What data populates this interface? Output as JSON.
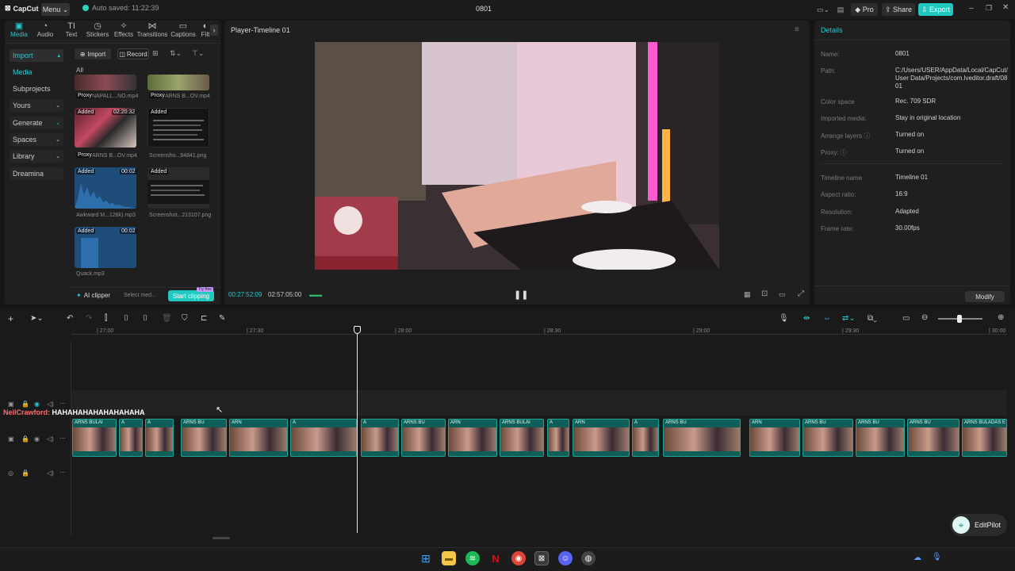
{
  "titlebar": {
    "app_name": "CapCut",
    "menu_label": "Menu",
    "autosave_text": "Auto saved: 11:22:39",
    "project_title": "0801",
    "pro_label": "Pro",
    "share_label": "Share",
    "export_label": "Export"
  },
  "toolbar": {
    "tools": [
      "Media",
      "Audio",
      "Text",
      "Stickers",
      "Effects",
      "Transitions",
      "Captions",
      "Filt"
    ]
  },
  "sidebar": {
    "items": [
      "Import",
      "Media",
      "Subprojects",
      "Yours",
      "Generate",
      "Spaces",
      "Library",
      "Dreamina"
    ]
  },
  "media": {
    "import_label": "Import",
    "record_label": "Record",
    "filter_all": "All",
    "items": [
      {
        "name": "NAPALL...NO.mp4",
        "badge": "Proxy",
        "duration": ""
      },
      {
        "name": "ARNS B...OV.mp4",
        "badge": "Proxy",
        "duration": ""
      },
      {
        "name": "ARNS B...OV.mp4",
        "badge": "Proxy",
        "added": "Added",
        "duration": "02:20:32"
      },
      {
        "name": "Screensho...94841.png",
        "badge": "",
        "added": "Added",
        "duration": ""
      },
      {
        "name": "Awkward M...128k).mp3",
        "badge": "",
        "added": "Added",
        "duration": "00:02"
      },
      {
        "name": "Screenshot...213107.png",
        "badge": "",
        "added": "Added",
        "duration": ""
      },
      {
        "name": "Quack.mp3",
        "badge": "",
        "added": "Added",
        "duration": "00:02"
      }
    ],
    "ai_clipper": "AI clipper",
    "select_media": "Select med...",
    "start_clipping": "Start clipping",
    "try_free": "Try free"
  },
  "player": {
    "title": "Player-Timeline 01",
    "current_time": "00:27:52:09",
    "total_time": "02:57:05:00"
  },
  "details": {
    "header": "Details",
    "rows": [
      {
        "label": "Name:",
        "value": "0801"
      },
      {
        "label": "Path:",
        "value": "C:/Users/USER/AppData/Local/CapCut/User Data/Projects/com.lveditor.draft/0801"
      },
      {
        "label": "Color space",
        "value": "Rec. 709 SDR"
      },
      {
        "label": "Imported media:",
        "value": "Stay in original location"
      },
      {
        "label": "Arrange layers",
        "value": "Turned on"
      },
      {
        "label": "Proxy:",
        "value": "Turned on"
      },
      {
        "label": "Timeline name",
        "value": "Timeline 01"
      },
      {
        "label": "Aspect ratio:",
        "value": "16:9"
      },
      {
        "label": "Resolution:",
        "value": "Adapted"
      },
      {
        "label": "Frame rate:",
        "value": "30.00fps"
      }
    ],
    "modify_label": "Modify"
  },
  "timeline": {
    "ticks": [
      "27:00",
      "27:30",
      "28:00",
      "28:30",
      "29:00",
      "29:30",
      "30:00"
    ],
    "caption_text": "NeilCrawford: HAHAHAHAHAHAHAHAHA",
    "caption_user": "NeilCrawford:",
    "caption_msg": "HAHAHAHAHAHAHAHAHA",
    "clip_label": "ARNS BULAI",
    "clip_labels": [
      "A",
      "ARNS BULAI",
      "A",
      "ARNS BU",
      "ARN",
      "ARNS BULADAS E"
    ]
  },
  "editpilot": {
    "label": "EditPilot"
  },
  "colors": {
    "accent": "#25c9d5",
    "clip_bg": "#0f5e57",
    "export_bg": "#1fc9c0"
  }
}
